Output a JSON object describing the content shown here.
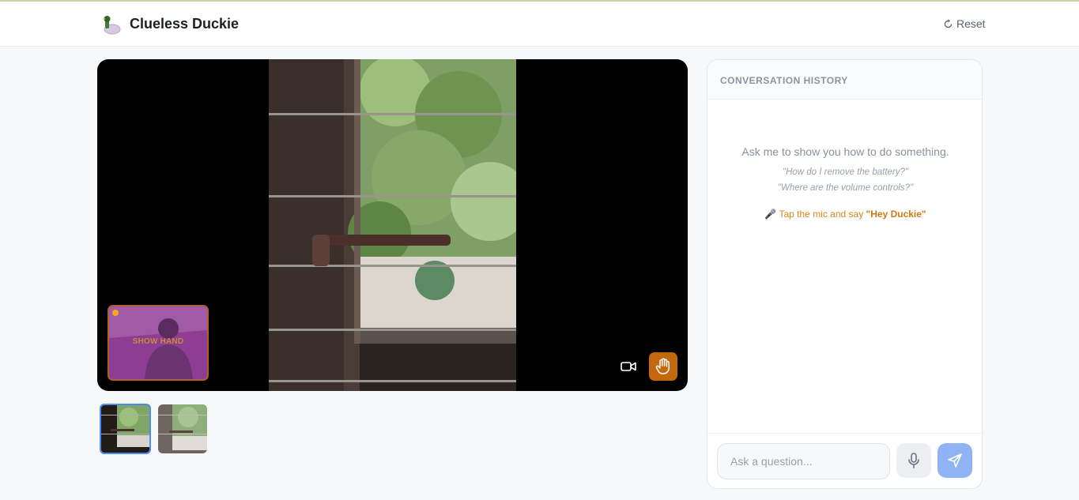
{
  "header": {
    "app_title": "Clueless Duckie",
    "reset_label": "Reset"
  },
  "stage": {
    "pip_label": "SHOW HAND",
    "controls": {
      "camera_icon": "video-camera-icon",
      "hand_icon": "hand-icon"
    }
  },
  "thumbnails": [
    {
      "name": "thumbnail-1",
      "selected": true
    },
    {
      "name": "thumbnail-2",
      "selected": false
    }
  ],
  "chat": {
    "title": "CONVERSATION HISTORY",
    "hint_main": "Ask me to show you how to do something.",
    "examples": [
      "\"How do I remove the battery?\"",
      "\"Where are the volume controls?\""
    ],
    "mic_hint_prefix": "Tap the mic and say ",
    "mic_hint_phrase": "\"Hey Duckie\"",
    "input_placeholder": "Ask a question..."
  },
  "colors": {
    "accent_orange": "#c4680f",
    "send_blue": "#8fb3f5",
    "selected_border": "#4b8cf5"
  }
}
